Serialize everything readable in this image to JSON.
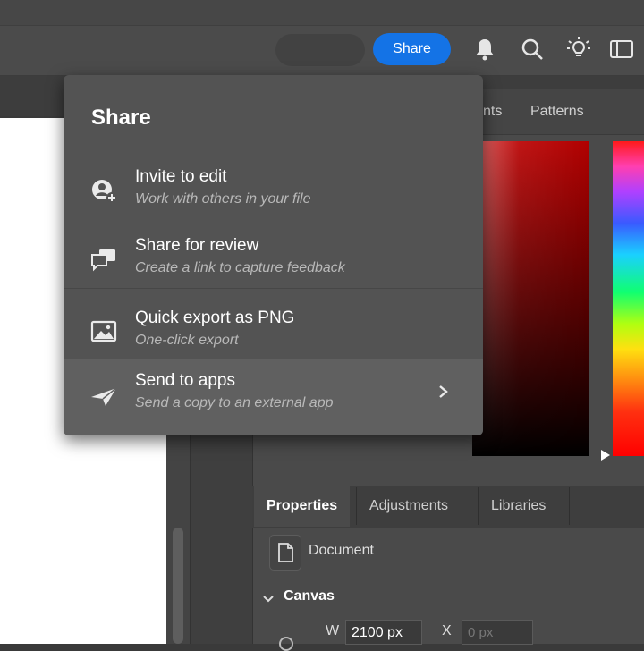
{
  "toolbar": {
    "share_label": "Share",
    "icons": [
      "bell-icon",
      "search-icon",
      "lightbulb-icon",
      "panel-toggle-icon"
    ]
  },
  "color_panel": {
    "tabs": [
      "nts",
      "Patterns"
    ]
  },
  "share_menu": {
    "title": "Share",
    "items": [
      {
        "title": "Invite to edit",
        "subtitle": "Work with others in your file",
        "icon": "invite-user-icon"
      },
      {
        "title": "Share for review",
        "subtitle": "Create a link to capture feedback",
        "icon": "comment-icon"
      },
      {
        "title": "Quick export as PNG",
        "subtitle": "One-click export",
        "icon": "image-icon"
      },
      {
        "title": "Send to apps",
        "subtitle": "Send a copy to an external app",
        "icon": "paper-plane-icon"
      }
    ]
  },
  "properties_panel": {
    "tabs": [
      "Properties",
      "Adjustments",
      "Libraries"
    ],
    "active_tab": "Properties",
    "document_label": "Document",
    "section": "Canvas",
    "width_label": "W",
    "width_value": "2100 px",
    "x_label": "X",
    "x_value": "0 px"
  },
  "colors": {
    "accent": "#1473e6",
    "menu_bg": "#535353"
  }
}
